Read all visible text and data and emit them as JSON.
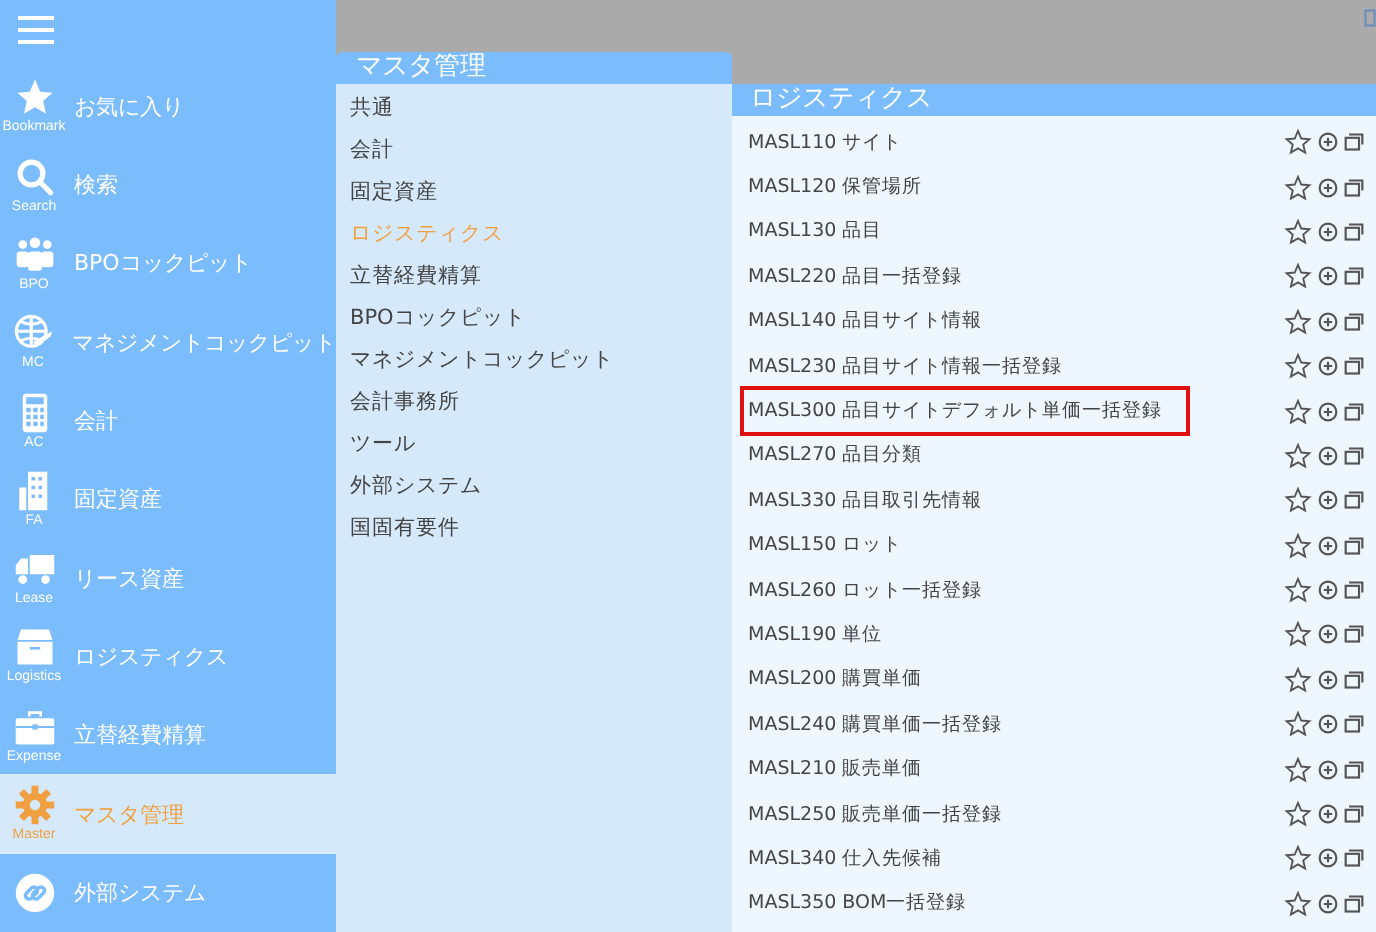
{
  "sidebar": {
    "items": [
      {
        "label": "お気に入り",
        "caption": "Bookmark",
        "selected": false
      },
      {
        "label": "検索",
        "caption": "Search",
        "selected": false
      },
      {
        "label": "BPOコックピット",
        "caption": "BPO",
        "selected": false
      },
      {
        "label": "マネジメントコックピット",
        "caption": "MC",
        "selected": false
      },
      {
        "label": "会計",
        "caption": "AC",
        "selected": false
      },
      {
        "label": "固定資産",
        "caption": "FA",
        "selected": false
      },
      {
        "label": "リース資産",
        "caption": "Lease",
        "selected": false
      },
      {
        "label": "ロジスティクス",
        "caption": "Logistics",
        "selected": false
      },
      {
        "label": "立替経費精算",
        "caption": "Expense",
        "selected": false
      },
      {
        "label": "マスタ管理",
        "caption": "Master",
        "selected": true
      },
      {
        "label": "外部システム",
        "selected": false
      }
    ]
  },
  "submenu": {
    "title": "マスタ管理",
    "items": [
      {
        "label": "共通",
        "selected": false
      },
      {
        "label": "会計",
        "selected": false
      },
      {
        "label": "固定資産",
        "selected": false
      },
      {
        "label": "ロジスティクス",
        "selected": true
      },
      {
        "label": "立替経費精算",
        "selected": false
      },
      {
        "label": "BPOコックピット",
        "selected": false
      },
      {
        "label": "マネジメントコックピット",
        "selected": false
      },
      {
        "label": "会計事務所",
        "selected": false
      },
      {
        "label": "ツール",
        "selected": false
      },
      {
        "label": "外部システム",
        "selected": false
      },
      {
        "label": "国固有要件",
        "selected": false
      }
    ]
  },
  "content": {
    "title": "ロジスティクス",
    "rows": [
      {
        "label": "MASL110 サイト",
        "highlighted": false
      },
      {
        "label": "MASL120 保管場所",
        "highlighted": false
      },
      {
        "label": "MASL130 品目",
        "highlighted": false
      },
      {
        "label": "MASL220 品目一括登録",
        "highlighted": false
      },
      {
        "label": "MASL140 品目サイト情報",
        "highlighted": false
      },
      {
        "label": "MASL230 品目サイト情報一括登録",
        "highlighted": false
      },
      {
        "label": "MASL300 品目サイトデフォルト単価一括登録",
        "highlighted": true
      },
      {
        "label": "MASL270 品目分類",
        "highlighted": false
      },
      {
        "label": "MASL330 品目取引先情報",
        "highlighted": false
      },
      {
        "label": "MASL150 ロット",
        "highlighted": false
      },
      {
        "label": "MASL260 ロット一括登録",
        "highlighted": false
      },
      {
        "label": "MASL190 単位",
        "highlighted": false
      },
      {
        "label": "MASL200 購買単価",
        "highlighted": false
      },
      {
        "label": "MASL240 購買単価一括登録",
        "highlighted": false
      },
      {
        "label": "MASL210 販売単価",
        "highlighted": false
      },
      {
        "label": "MASL250 販売単価一括登録",
        "highlighted": false
      },
      {
        "label": "MASL340 仕入先候補",
        "highlighted": false
      },
      {
        "label": "MASL350 BOM一括登録",
        "highlighted": false
      }
    ]
  }
}
